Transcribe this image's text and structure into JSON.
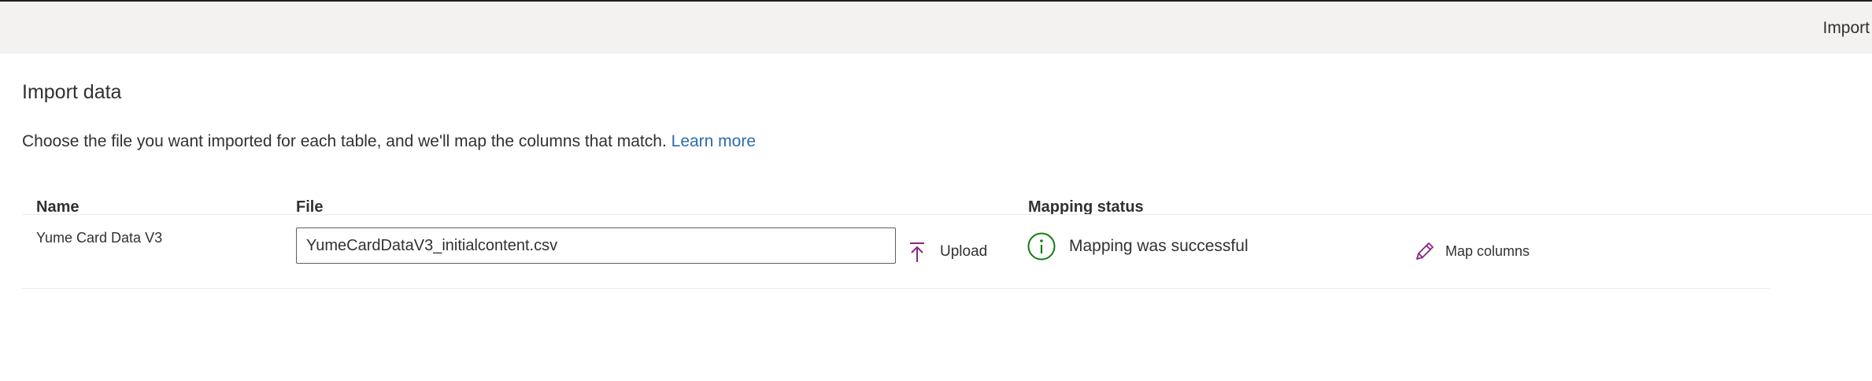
{
  "top_bar": {
    "import_label": "Import"
  },
  "page": {
    "title": "Import data",
    "description": "Choose the file you want imported for each table, and we'll map the columns that match.",
    "learn_more_label": "Learn more"
  },
  "table": {
    "columns": {
      "name": "Name",
      "file": "File",
      "mapping_status": "Mapping status"
    },
    "rows": [
      {
        "name": "Yume Card Data V3",
        "file_value": "YumeCardDataV3_initialcontent.csv",
        "upload_label": "Upload",
        "mapping_status": "Mapping was successful",
        "map_columns_label": "Map columns"
      }
    ]
  },
  "icons": {
    "upload": "upload-icon",
    "status": "info-circle-icon",
    "map_columns": "pencil-icon"
  },
  "colors": {
    "accent_purple": "#8a2680",
    "success_green": "#107c10",
    "link_blue": "#2b6cb0",
    "top_bar_bg": "#f3f2f1"
  }
}
